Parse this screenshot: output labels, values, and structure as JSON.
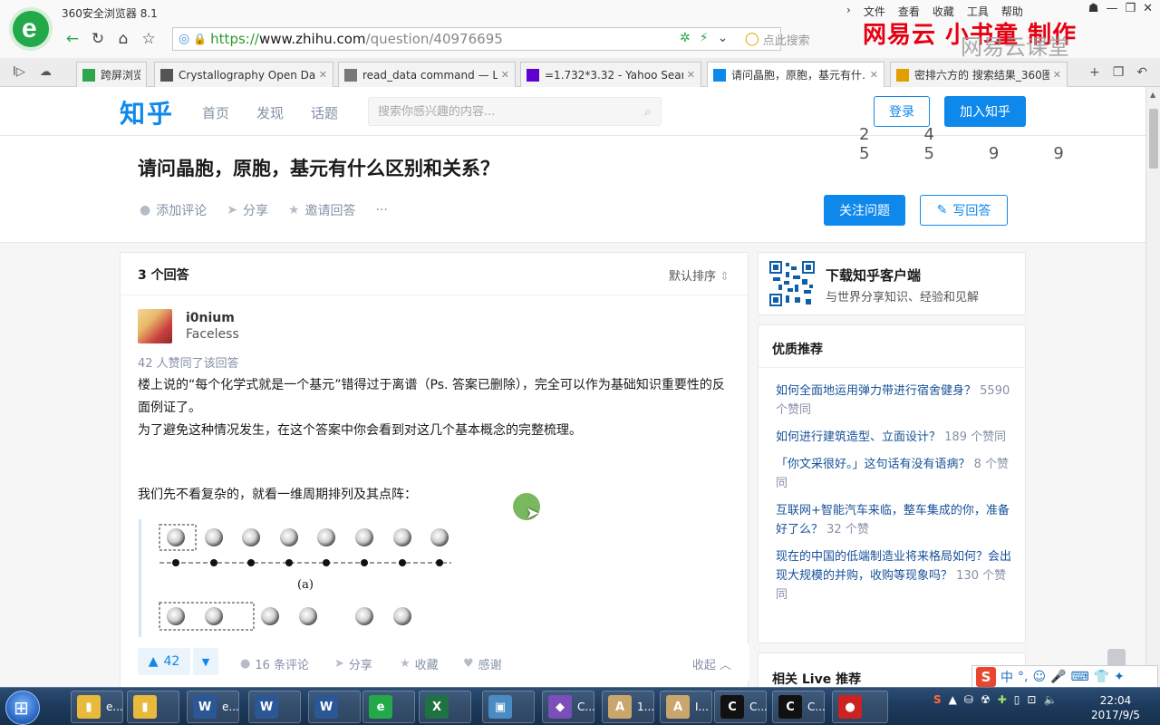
{
  "browser": {
    "app_title": "360安全浏览器 8.1",
    "menu": [
      "文件",
      "查看",
      "收藏",
      "工具",
      "帮助"
    ],
    "url": {
      "scheme": "https://",
      "host": "www.zhihu.com",
      "path": "/question/40976695"
    },
    "search_placeholder": "点此搜索",
    "watermark": "网易云 小书童 制作",
    "watermark2": "网易云课堂",
    "tabs": [
      {
        "label": "跨屏浏览",
        "active": false,
        "color": "#2fa64b"
      },
      {
        "label": "Crystallography Open Da",
        "active": false,
        "color": "#555555"
      },
      {
        "label": "read_data command — L",
        "active": false,
        "color": "#777777"
      },
      {
        "label": "=1.732*3.32 - Yahoo Sear",
        "active": false,
        "color": "#5f01d1"
      },
      {
        "label": "请问晶胞，原胞，基元有什…",
        "active": true,
        "color": "#0f88eb"
      },
      {
        "label": "密排六方的 搜索结果_360图",
        "active": false,
        "color": "#e0a100"
      }
    ]
  },
  "zhihu": {
    "logo": "知乎",
    "nav": [
      "首页",
      "发现",
      "话题"
    ],
    "search_placeholder": "搜索你感兴趣的内容...",
    "login": "登录",
    "join": "加入知乎",
    "faded_stats": "24 5599",
    "question": {
      "title": "请问晶胞，原胞，基元有什么区别和关系？",
      "actions": [
        "添加评论",
        "分享",
        "邀请回答",
        "···"
      ],
      "follow": "关注问题",
      "write": "写回答"
    },
    "answers": {
      "count": "3 个回答",
      "sort": "默认排序",
      "author": "i0nium",
      "author_tag": "Faceless",
      "votes_line": "42 人赞同了该回答",
      "body": [
        "楼上说的“每个化学式就是一个基元”错得过于离谱（Ps. 答案已删除），完全可以作为基础知识重要性的反面例证了。",
        "为了避免这种情况发生，在这个答案中你会看到对这几个基本概念的完整梳理。"
      ],
      "para_lattice": "我们先不看复杂的，就看一维周期排列及其点阵：",
      "figure_label": "(a)",
      "footer": {
        "votes": "42",
        "comments": "16 条评论",
        "share": "分享",
        "collect": "收藏",
        "thanks": "感谢",
        "collapse": "收起"
      }
    },
    "sidebar": {
      "download_title": "下载知乎客户端",
      "download_sub": "与世界分享知识、经验和见解",
      "reco_title": "优质推荐",
      "reco": [
        {
          "title": "如何全面地运用弹力带进行宿舍健身？",
          "count": "5590 个赞同"
        },
        {
          "title": "如何进行建筑造型、立面设计？",
          "count": "189 个赞同"
        },
        {
          "title": "「你文采很好。」这句话有没有语病？",
          "count": "8 个赞同"
        },
        {
          "title": "互联网+智能汽车来临，整车集成的你，准备好了么？",
          "count": "32 个赞"
        },
        {
          "title": "现在的中国的低端制造业将来格局如何？会出现大规模的并购，收购等现象吗？",
          "count": "130 个赞同"
        }
      ],
      "live_title": "相关 Live 推荐"
    }
  },
  "taskbar": {
    "items": [
      {
        "label": "e...",
        "color": "#e8b93a",
        "glyph": "▮"
      },
      {
        "label": "",
        "color": "#e8b93a",
        "glyph": "▮"
      },
      {
        "label": "e...",
        "color": "#2b5797",
        "glyph": "W"
      },
      {
        "label": "",
        "color": "#2b5797",
        "glyph": "W"
      },
      {
        "label": "",
        "color": "#2b5797",
        "glyph": "W"
      },
      {
        "label": "",
        "color": "#23a84a",
        "glyph": "e"
      },
      {
        "label": "",
        "color": "#1f7244",
        "glyph": "X"
      },
      {
        "label": "",
        "color": "#4a8bc4",
        "glyph": "▣"
      },
      {
        "label": "C...",
        "color": "#7a4fb8",
        "glyph": "◆"
      },
      {
        "label": "1...",
        "color": "#c9a76c",
        "glyph": "A"
      },
      {
        "label": "I...",
        "color": "#c9a76c",
        "glyph": "A"
      },
      {
        "label": "C...",
        "color": "#111111",
        "glyph": "C"
      },
      {
        "label": "C...",
        "color": "#111111",
        "glyph": "C"
      },
      {
        "label": "",
        "color": "#cc2222",
        "glyph": "●"
      }
    ],
    "time": "22:04",
    "date": "2017/9/5",
    "ime": "中"
  }
}
